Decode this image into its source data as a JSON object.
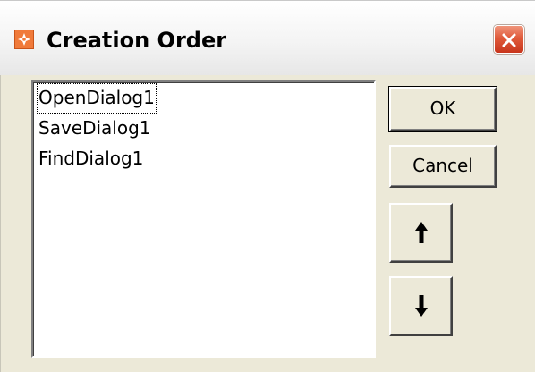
{
  "window": {
    "title": "Creation Order"
  },
  "icons": {
    "app": "app-icon",
    "close": "close-icon",
    "up": "arrow-up-icon",
    "down": "arrow-down-icon"
  },
  "listbox": {
    "items": [
      {
        "label": "OpenDialog1",
        "focused": true
      },
      {
        "label": "SaveDialog1",
        "focused": false
      },
      {
        "label": "FindDialog1",
        "focused": false
      }
    ]
  },
  "buttons": {
    "ok_label": "OK",
    "cancel_label": "Cancel"
  },
  "colors": {
    "dialog_face": "#ece9d8",
    "close_button": "#e05a3a",
    "app_icon": "#f07a3a"
  }
}
